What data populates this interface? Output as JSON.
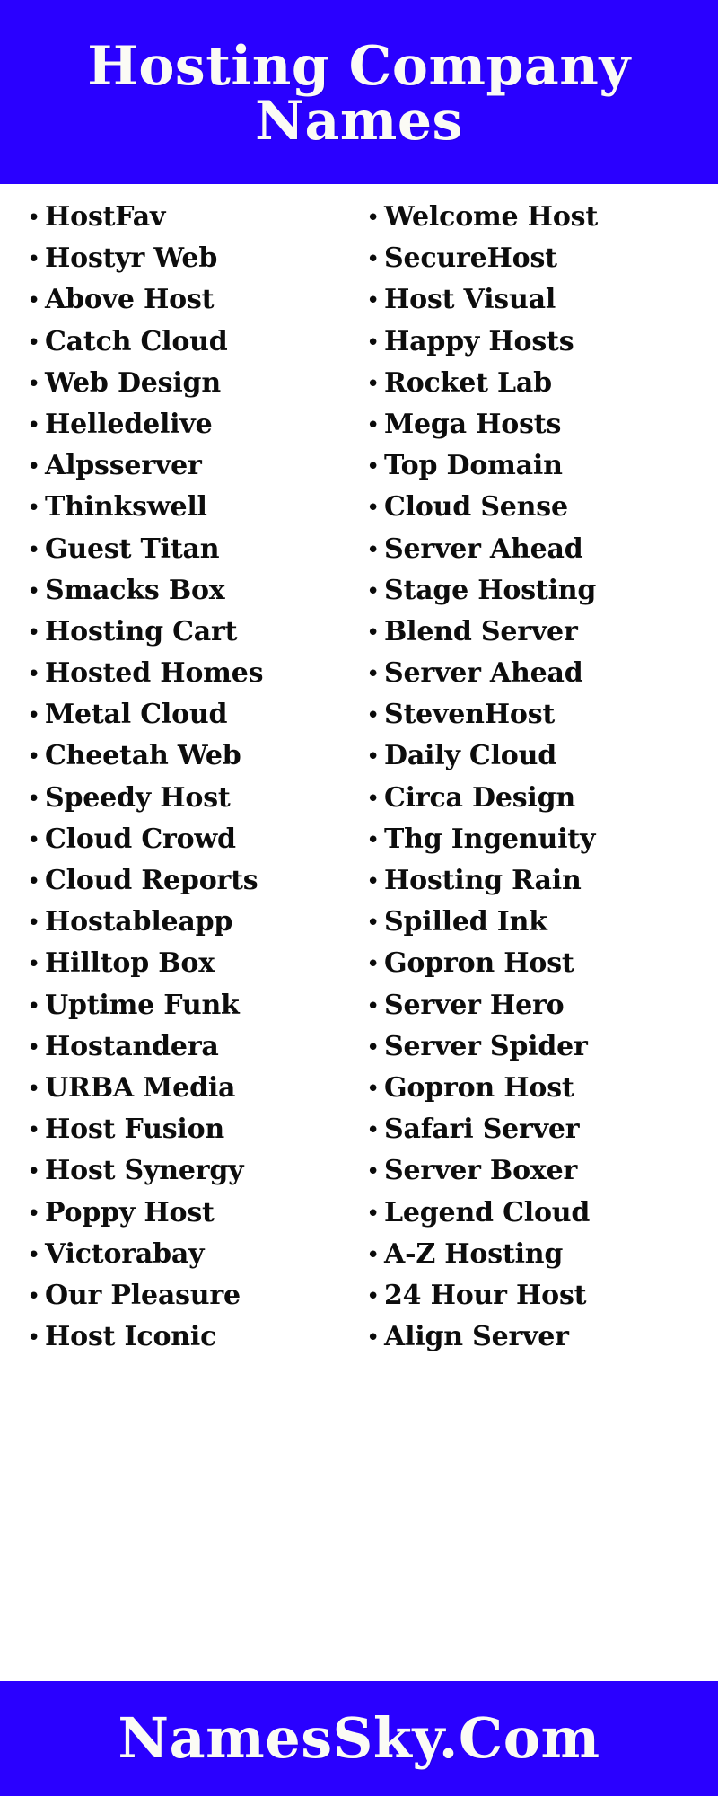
{
  "theme": {
    "brand_color": "#2a00ff",
    "header_text_color": "#fbfbf5",
    "body_background": "#ffffff",
    "list_text_color": "#0d0d0d"
  },
  "header": {
    "title_line_1": "Hosting Company",
    "title_line_2": "Names",
    "title_full": "Hosting Company Names"
  },
  "bullet_glyph": "•",
  "columns": {
    "left": [
      {
        "label": "HostFav"
      },
      {
        "label": "Hostyr Web"
      },
      {
        "label": "Above Host"
      },
      {
        "label": "Catch Cloud"
      },
      {
        "label": "Web Design"
      },
      {
        "label": "Helledelive"
      },
      {
        "label": "Alpsserver"
      },
      {
        "label": "Thinkswell"
      },
      {
        "label": "Guest Titan"
      },
      {
        "label": "Smacks Box"
      },
      {
        "label": "Hosting Cart"
      },
      {
        "label": "Hosted Homes"
      },
      {
        "label": "Metal Cloud"
      },
      {
        "label": "Cheetah Web"
      },
      {
        "label": "Speedy Host"
      },
      {
        "label": "Cloud Crowd"
      },
      {
        "label": "Cloud Reports"
      },
      {
        "label": "Hostableapp"
      },
      {
        "label": "Hilltop Box"
      },
      {
        "label": "Uptime Funk"
      },
      {
        "label": "Hostandera"
      },
      {
        "label": "URBA Media"
      },
      {
        "label": "Host Fusion"
      },
      {
        "label": "Host Synergy"
      },
      {
        "label": "Poppy Host"
      },
      {
        "label": "Victorabay"
      },
      {
        "label": "Our Pleasure"
      },
      {
        "label": "Host Iconic"
      }
    ],
    "right": [
      {
        "label": "Welcome Host"
      },
      {
        "label": "SecureHost"
      },
      {
        "label": "Host Visual"
      },
      {
        "label": "Happy Hosts"
      },
      {
        "label": "Rocket Lab"
      },
      {
        "label": "Mega Hosts"
      },
      {
        "label": "Top Domain"
      },
      {
        "label": "Cloud Sense"
      },
      {
        "label": "Server Ahead"
      },
      {
        "label": "Stage Hosting"
      },
      {
        "label": "Blend Server"
      },
      {
        "label": "Server Ahead"
      },
      {
        "label": "StevenHost"
      },
      {
        "label": "Daily Cloud"
      },
      {
        "label": "Circa Design"
      },
      {
        "label": "Thg Ingenuity"
      },
      {
        "label": "Hosting Rain"
      },
      {
        "label": "Spilled Ink"
      },
      {
        "label": "Gopron Host"
      },
      {
        "label": "Server Hero"
      },
      {
        "label": "Server Spider"
      },
      {
        "label": "Gopron Host"
      },
      {
        "label": "Safari Server"
      },
      {
        "label": "Server Boxer"
      },
      {
        "label": "Legend Cloud"
      },
      {
        "label": "A-Z Hosting"
      },
      {
        "label": "24 Hour Host"
      },
      {
        "label": "Align Server"
      }
    ]
  },
  "footer": {
    "brand": "NamesSky.Com"
  }
}
